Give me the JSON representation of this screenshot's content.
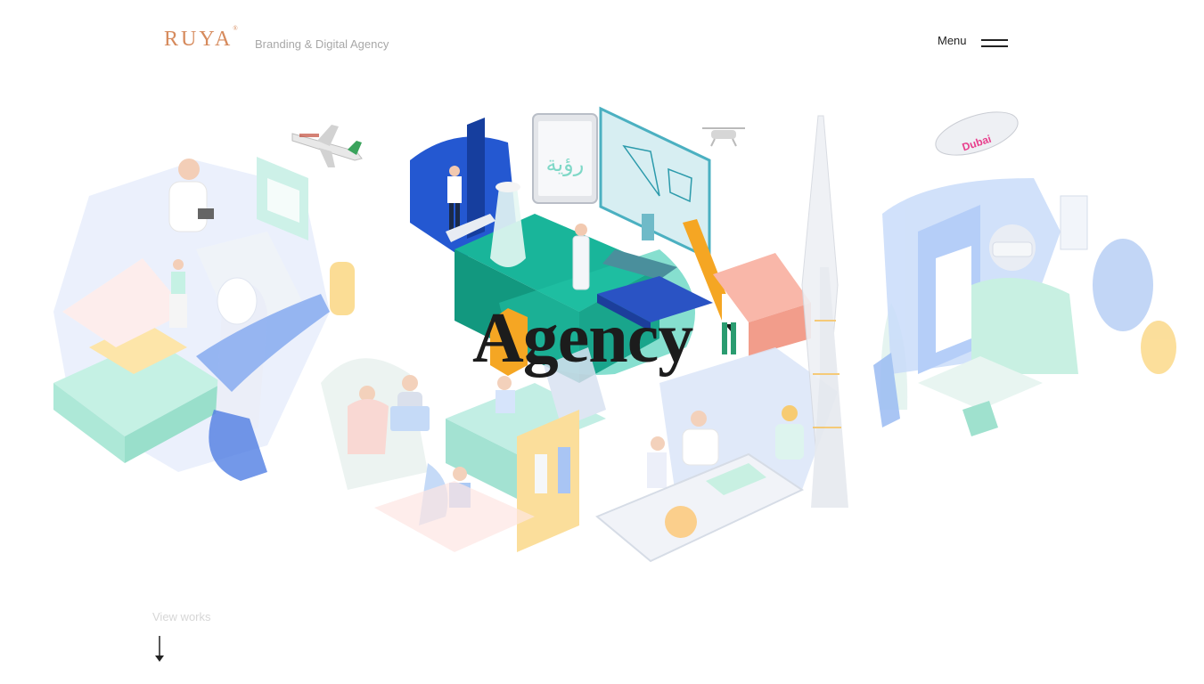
{
  "header": {
    "logo_text": "RUYA",
    "logo_mark": "®",
    "tagline": "Branding & Digital Agency",
    "menu_label": "Menu"
  },
  "hero": {
    "title": "Agency",
    "arabic_sign": "رؤية",
    "blimp_text": "Dubai"
  },
  "footer": {
    "view_works_label": "View works"
  },
  "colors": {
    "brand": "#d68a5c",
    "blue": "#2b5fd6",
    "teal": "#1fb39a",
    "orange": "#f5a623",
    "pastel_blue": "#b8cff5",
    "pastel_mint": "#9ee6d2",
    "pastel_pink": "#f8d2cc",
    "pastel_yellow": "#fbd98a"
  },
  "icons": {
    "menu": "hamburger-icon",
    "scroll": "arrow-down-icon"
  }
}
